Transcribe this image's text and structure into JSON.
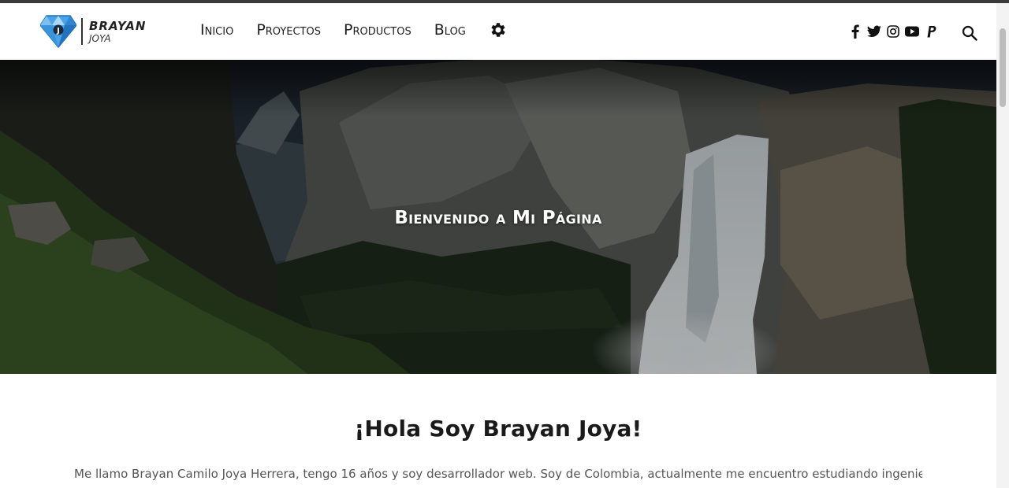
{
  "brand": {
    "name": "BRAYAN",
    "sub": "JOYA"
  },
  "nav": {
    "items": [
      {
        "label": "Inicio"
      },
      {
        "label": "Proyectos"
      },
      {
        "label": "Productos"
      },
      {
        "label": "Blog"
      }
    ],
    "settings_icon": "gear-icon"
  },
  "social": {
    "icons": [
      "facebook-icon",
      "twitter-icon",
      "instagram-icon",
      "youtube-icon",
      "paypal-icon"
    ]
  },
  "search_icon": "search-icon",
  "hero": {
    "title": "Bienvenido a Mi Página"
  },
  "about": {
    "heading": "¡Hola Soy Brayan Joya!",
    "intro": "Me llamo Brayan Camilo Joya Herrera, tengo 16 años y soy desarrollador web. Soy de Colombia, actualmente me encuentro estudiando ingeniería"
  },
  "colors": {
    "text": "#1e1e1e",
    "hero_text": "#ffffff",
    "gem": "#4aa3e8"
  }
}
